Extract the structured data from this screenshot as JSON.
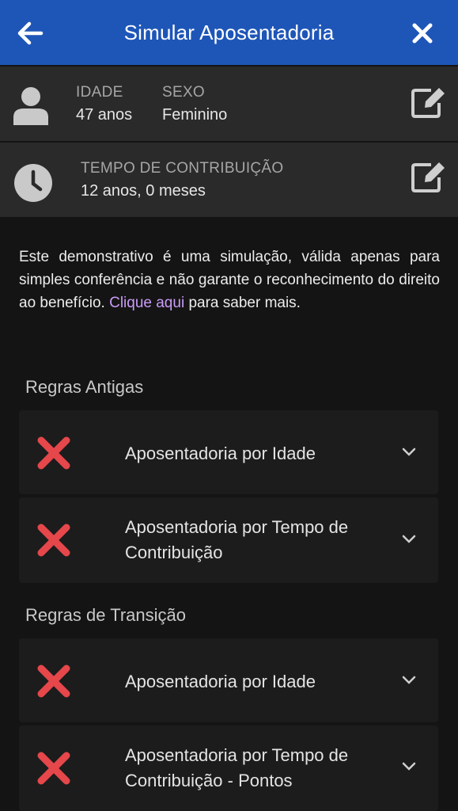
{
  "header": {
    "title": "Simular Aposentadoria",
    "back_icon": "arrow-left-icon",
    "close_icon": "close-icon",
    "bg_color": "#1e56b8"
  },
  "profile": {
    "age_label": "IDADE",
    "age_value": "47 anos",
    "sex_label": "SEXO",
    "sex_value": "Feminino",
    "contribution_label": "TEMPO DE CONTRIBUIÇÃO",
    "contribution_value": "12 anos, 0 meses"
  },
  "disclaimer": {
    "text": "Este demonstrativo é uma simulação, válida apenas para simples conferência e não garante o reconhecimento do direito ao benefício. ",
    "link": "Clique aqui",
    "after": " para saber mais.",
    "link_color": "#c99cf7"
  },
  "sections": [
    {
      "title": "Regras Antigas",
      "items": [
        {
          "label": "Aposentadoria por Idade",
          "status": "not-eligible"
        },
        {
          "label": "Aposentadoria por Tempo de Contribuição",
          "status": "not-eligible"
        }
      ]
    },
    {
      "title": "Regras de Transição",
      "items": [
        {
          "label": "Aposentadoria por Idade",
          "status": "not-eligible"
        },
        {
          "label": "Aposentadoria por Tempo de Contribuição - Pontos",
          "status": "not-eligible"
        }
      ]
    }
  ],
  "colors": {
    "status_fail": "#e5474b"
  }
}
